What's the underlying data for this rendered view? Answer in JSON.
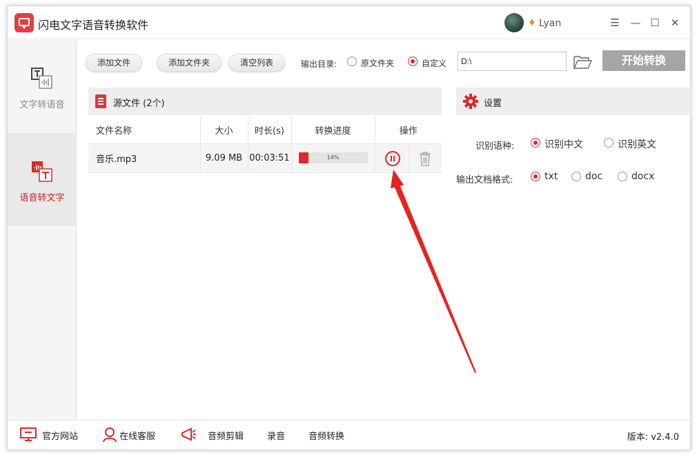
{
  "window": {
    "title": "闪电文字语音转换软件",
    "username": "Lyan",
    "controls": [
      "☰",
      "—",
      "☐",
      "✕"
    ]
  },
  "sidebar": {
    "items": [
      {
        "label": "文字转语音",
        "active": false
      },
      {
        "label": "语音转文字",
        "active": true
      }
    ]
  },
  "toolbar": {
    "add_file": "添加文件",
    "add_folder": "添加文件夹",
    "clear_list": "清空列表",
    "output_dir_label": "输出目录:",
    "opt_source_folder": "原文件夹",
    "opt_custom": "自定义",
    "selected_output": "自定义",
    "path_value": "D:\\",
    "start_button": "开始转换"
  },
  "source": {
    "title": "源文件 (2个)",
    "columns": [
      "文件名称",
      "大小",
      "时长(s)",
      "转换进度",
      "操作"
    ],
    "rows": [
      {
        "name": "音乐.mp3",
        "size": "9.09 MB",
        "duration": "00:03:51",
        "progress_label": "14%",
        "progress": 0.14
      }
    ]
  },
  "settings": {
    "title": "设置",
    "lang_label": "识别语种:",
    "lang_options": [
      "识别中文",
      "识别英文"
    ],
    "lang_selected": "识别中文",
    "format_label": "输出文档格式:",
    "format_options": [
      "txt",
      "doc",
      "docx"
    ],
    "format_selected": "txt"
  },
  "footer": {
    "items": [
      "官方网站",
      "在线客服",
      "音频剪辑",
      "录音",
      "音频转换"
    ],
    "version": "版本: v2.4.0"
  },
  "colors": {
    "accent": "#e02626",
    "start_disabled": "#a5a5a5",
    "panel_header": "#eeeeee"
  }
}
